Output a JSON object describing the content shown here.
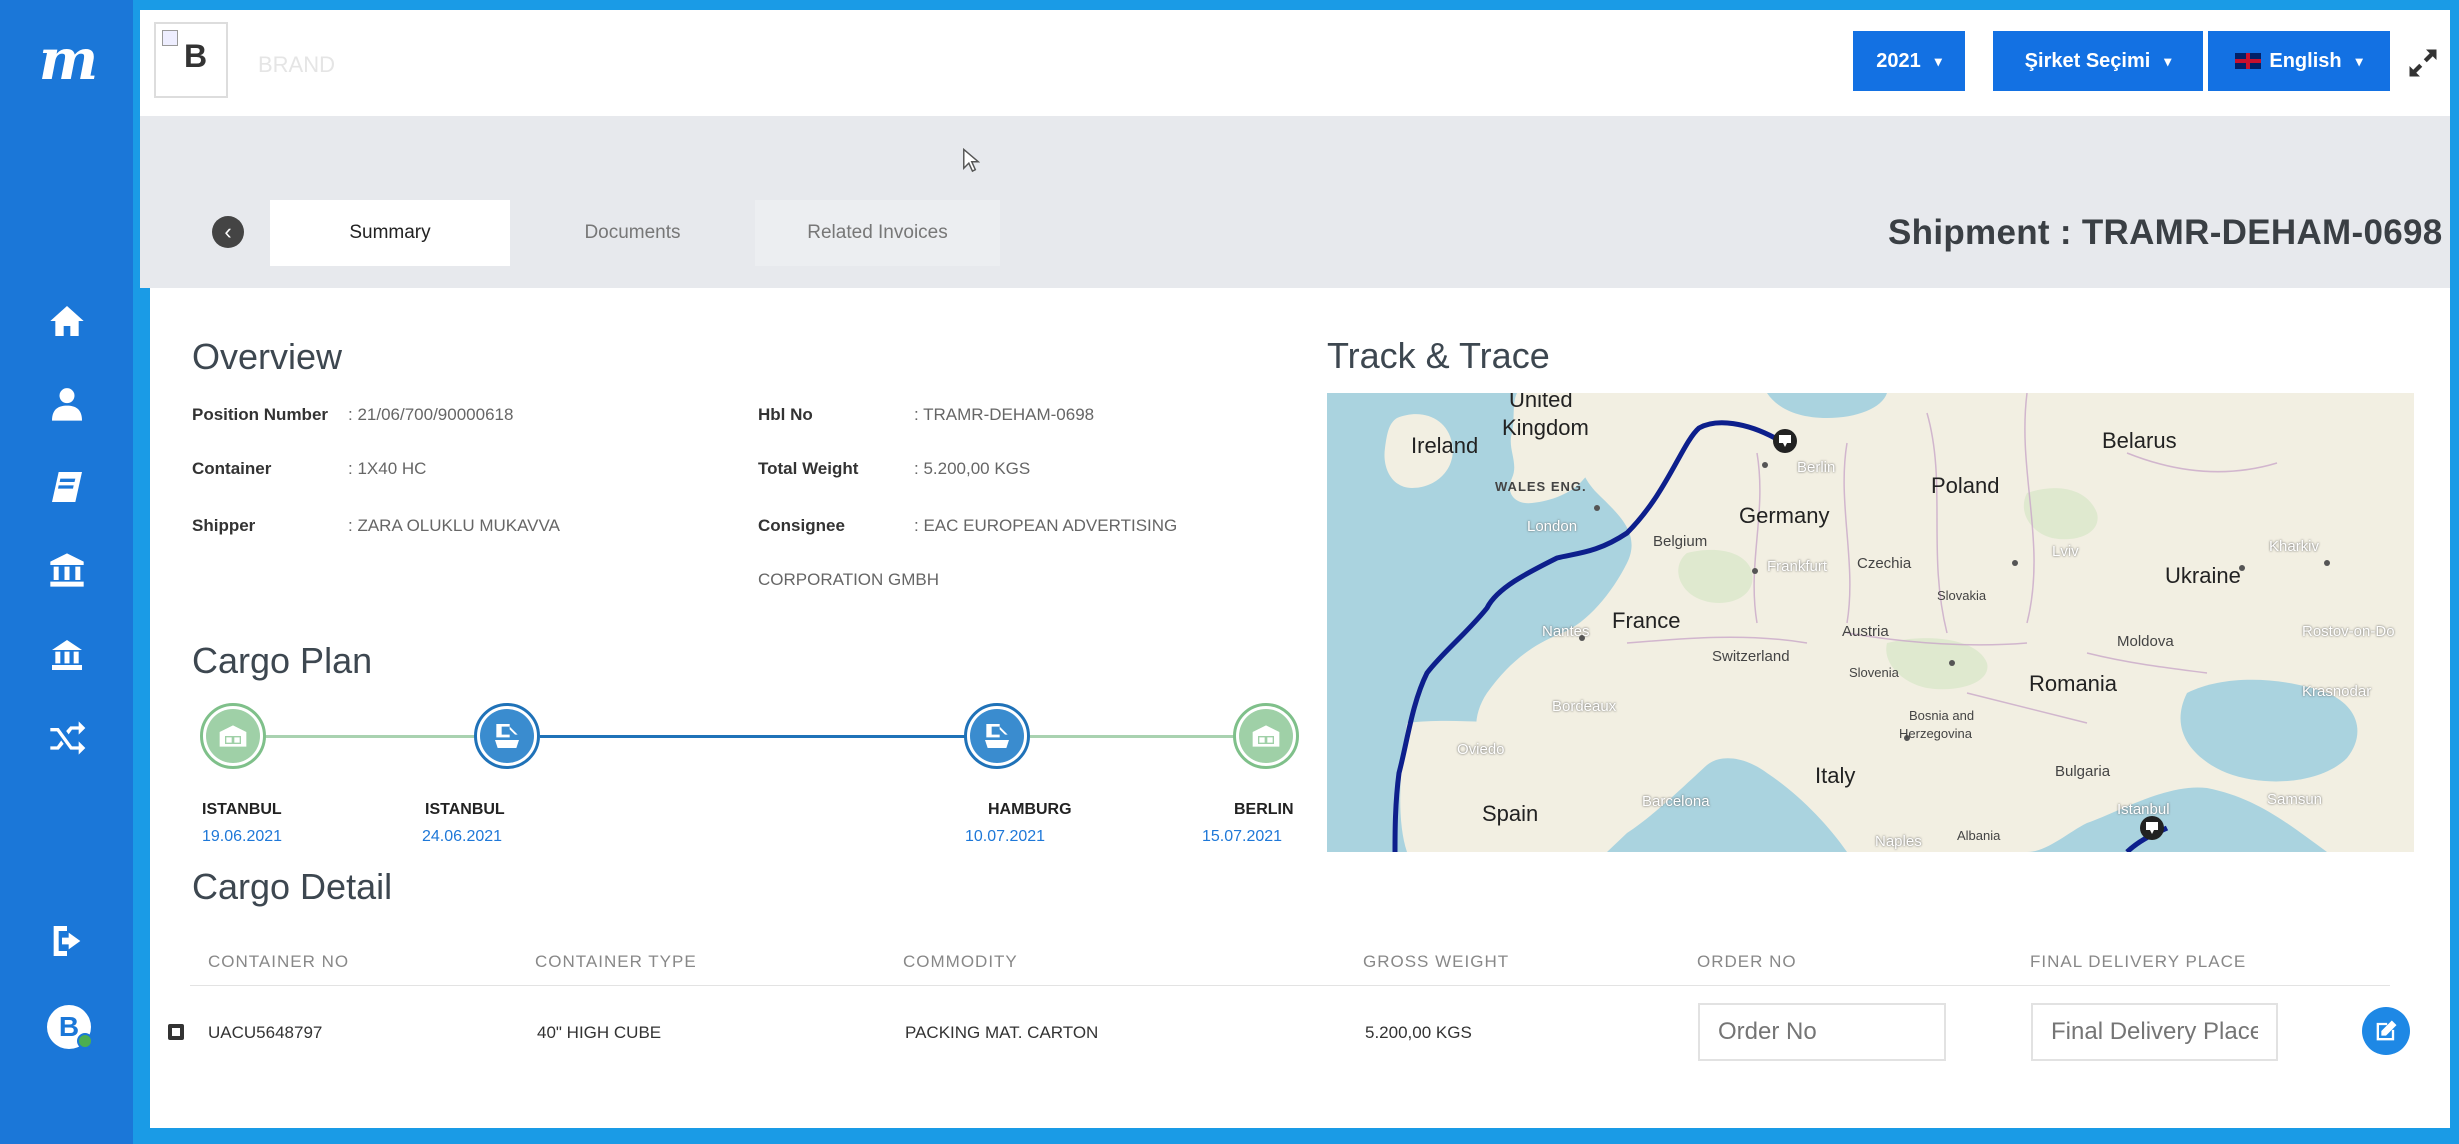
{
  "sidebar": {
    "logo_text": "m",
    "user_initial": "B",
    "nav": [
      "home-icon",
      "user-icon",
      "book-icon",
      "bank-icon",
      "bank-alt-icon",
      "shuffle-icon"
    ],
    "logout_icon": "sign-out-icon"
  },
  "topbar": {
    "brand_alt": "B",
    "brand_name": "BRAND",
    "year_label": "2021",
    "company_label": "Şirket Seçimi",
    "language_label": "English",
    "expand_icon": "expand-icon"
  },
  "tabs": [
    {
      "label": "Summary",
      "active": true
    },
    {
      "label": "Documents",
      "active": false
    },
    {
      "label": "Related Invoices",
      "active": false
    }
  ],
  "shipment_title": "Shipment : TRAMR-DEHAM-0698",
  "overview": {
    "title": "Overview",
    "fields": {
      "position_label": "Position Number",
      "position_value": ": 21/06/700/90000618",
      "container_label": "Container",
      "container_value": ": 1X40 HC",
      "shipper_label": "Shipper",
      "shipper_value": ": ZARA OLUKLU MUKAVVA",
      "hbl_label": "Hbl No",
      "hbl_value": ": TRAMR-DEHAM-0698",
      "weight_label": "Total Weight",
      "weight_value": ": 5.200,00 KGS",
      "consignee_label": "Consignee",
      "consignee_value": ": EAC EUROPEAN ADVERTISING",
      "consignee_value2": "CORPORATION GMBH"
    }
  },
  "cargo_plan": {
    "title": "Cargo Plan",
    "stops": [
      {
        "city": "ISTANBUL",
        "date": "19.06.2021"
      },
      {
        "city": "ISTANBUL",
        "date": "24.06.2021"
      },
      {
        "city": "HAMBURG",
        "date": "10.07.2021"
      },
      {
        "city": "BERLIN",
        "date": "15.07.2021"
      }
    ]
  },
  "track": {
    "title": "Track & Trace",
    "labels": {
      "uk1": "United",
      "uk2": "Kingdom",
      "ireland": "Ireland",
      "wales": "WALES ENG.",
      "london": "London",
      "belgium": "Belgium",
      "germany": "Germany",
      "berlin": "Berlin",
      "poland": "Poland",
      "belarus": "Belarus",
      "frankfurt": "Frankfurt",
      "czechia": "Czechia",
      "lviv": "Lviv",
      "kharkiv": "Kharkiv",
      "ukraine": "Ukraine",
      "slovakia": "Slovakia",
      "nantes": "Nantes",
      "france": "France",
      "switzerland": "Switzerland",
      "austria": "Austria",
      "moldova": "Moldova",
      "rostov": "Rostov-on-Do",
      "slovenia": "Slovenia",
      "romania": "Romania",
      "krasnodar": "Krasnodar",
      "bordeaux": "Bordeaux",
      "bosnia1": "Bosnia and",
      "bosnia2": "Herzegovina",
      "oviedo": "Oviedo",
      "italy": "Italy",
      "bulgaria": "Bulgaria",
      "spain": "Spain",
      "barcelona": "Barcelona",
      "istanbul": "Istanbul",
      "samsun": "Samsun",
      "albania": "Albania",
      "naples": "Naples"
    }
  },
  "cargo_detail": {
    "title": "Cargo Detail",
    "headers": [
      "CONTAINER NO",
      "CONTAINER TYPE",
      "COMMODITY",
      "GROSS WEIGHT",
      "ORDER NO",
      "FINAL DELIVERY PLACE"
    ],
    "rows": [
      {
        "container_no": "UACU5648797",
        "container_type": "40\" HIGH CUBE",
        "commodity": "PACKING MAT. CARTON",
        "gross_weight": "5.200,00 KGS"
      }
    ],
    "order_placeholder": "Order No",
    "delivery_placeholder": "Final Delivery Place"
  },
  "colors": {
    "accent": "#1371e3",
    "sidebar": "#1b77d8",
    "route": "#0d1f8c",
    "plan_done": "#7fc08a",
    "plan_active": "#1f72b8"
  }
}
